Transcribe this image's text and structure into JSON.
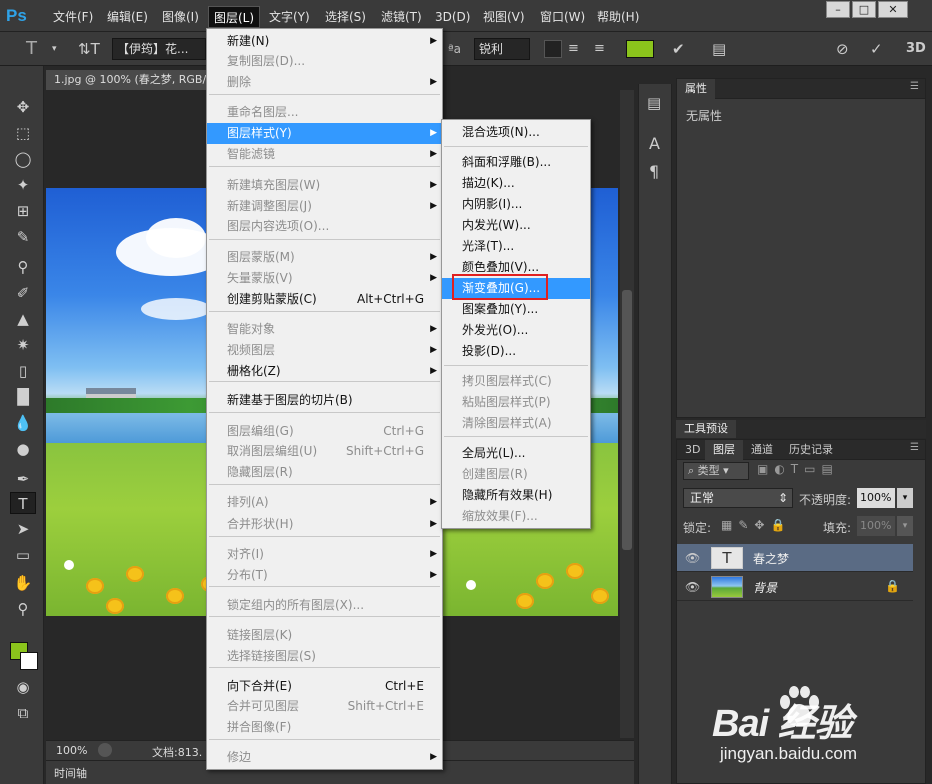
{
  "app": {
    "logo": "Ps"
  },
  "menubar": {
    "items": [
      "文件(F)",
      "编辑(E)",
      "图像(I)",
      "图层(L)",
      "文字(Y)",
      "选择(S)",
      "滤镜(T)",
      "3D(D)",
      "视图(V)",
      "窗口(W)",
      "帮助(H)"
    ],
    "active_index": 3
  },
  "options": {
    "font_name": "【伊筠】花...",
    "aa_label": "ªa",
    "aa_mode": "锐利",
    "color": "#8bc41c"
  },
  "document": {
    "tab_title": "1.jpg @ 100% (春之梦, RGB/8)",
    "zoom": "100%",
    "doc_info": "文档:813.",
    "timeline_label": "时间轴"
  },
  "layer_menu": {
    "items": [
      {
        "label": "新建(N)",
        "shortcut": "",
        "submenu": true,
        "disabled": false
      },
      {
        "label": "复制图层(D)...",
        "shortcut": "",
        "submenu": false,
        "disabled": true
      },
      {
        "label": "删除",
        "shortcut": "",
        "submenu": true,
        "disabled": true
      },
      {
        "label": "重命名图层...",
        "shortcut": "",
        "submenu": false,
        "disabled": true
      },
      {
        "label": "图层样式(Y)",
        "shortcut": "",
        "submenu": true,
        "disabled": false
      },
      {
        "label": "智能滤镜",
        "shortcut": "",
        "submenu": true,
        "disabled": true
      },
      {
        "label": "新建填充图层(W)",
        "shortcut": "",
        "submenu": true,
        "disabled": true
      },
      {
        "label": "新建调整图层(J)",
        "shortcut": "",
        "submenu": true,
        "disabled": true
      },
      {
        "label": "图层内容选项(O)...",
        "shortcut": "",
        "submenu": false,
        "disabled": true
      },
      {
        "label": "图层蒙版(M)",
        "shortcut": "",
        "submenu": true,
        "disabled": true
      },
      {
        "label": "矢量蒙版(V)",
        "shortcut": "",
        "submenu": true,
        "disabled": true
      },
      {
        "label": "创建剪贴蒙版(C)",
        "shortcut": "Alt+Ctrl+G",
        "submenu": false,
        "disabled": false
      },
      {
        "label": "智能对象",
        "shortcut": "",
        "submenu": true,
        "disabled": true
      },
      {
        "label": "视频图层",
        "shortcut": "",
        "submenu": true,
        "disabled": true
      },
      {
        "label": "栅格化(Z)",
        "shortcut": "",
        "submenu": true,
        "disabled": false
      },
      {
        "label": "新建基于图层的切片(B)",
        "shortcut": "",
        "submenu": false,
        "disabled": false
      },
      {
        "label": "图层编组(G)",
        "shortcut": "Ctrl+G",
        "submenu": false,
        "disabled": true
      },
      {
        "label": "取消图层编组(U)",
        "shortcut": "Shift+Ctrl+G",
        "submenu": false,
        "disabled": true
      },
      {
        "label": "隐藏图层(R)",
        "shortcut": "",
        "submenu": false,
        "disabled": true
      },
      {
        "label": "排列(A)",
        "shortcut": "",
        "submenu": true,
        "disabled": true
      },
      {
        "label": "合并形状(H)",
        "shortcut": "",
        "submenu": true,
        "disabled": true
      },
      {
        "label": "对齐(I)",
        "shortcut": "",
        "submenu": true,
        "disabled": true
      },
      {
        "label": "分布(T)",
        "shortcut": "",
        "submenu": true,
        "disabled": true
      },
      {
        "label": "锁定组内的所有图层(X)...",
        "shortcut": "",
        "submenu": false,
        "disabled": true
      },
      {
        "label": "链接图层(K)",
        "shortcut": "",
        "submenu": false,
        "disabled": true
      },
      {
        "label": "选择链接图层(S)",
        "shortcut": "",
        "submenu": false,
        "disabled": true
      },
      {
        "label": "向下合并(E)",
        "shortcut": "Ctrl+E",
        "submenu": false,
        "disabled": false
      },
      {
        "label": "合并可见图层",
        "shortcut": "Shift+Ctrl+E",
        "submenu": false,
        "disabled": true
      },
      {
        "label": "拼合图像(F)",
        "shortcut": "",
        "submenu": false,
        "disabled": true
      },
      {
        "label": "修边",
        "shortcut": "",
        "submenu": true,
        "disabled": true
      }
    ]
  },
  "style_menu": {
    "items": [
      {
        "label": "混合选项(N)...",
        "disabled": false
      },
      {
        "label": "斜面和浮雕(B)...",
        "disabled": false
      },
      {
        "label": "描边(K)...",
        "disabled": false
      },
      {
        "label": "内阴影(I)...",
        "disabled": false
      },
      {
        "label": "内发光(W)...",
        "disabled": false
      },
      {
        "label": "光泽(T)...",
        "disabled": false
      },
      {
        "label": "颜色叠加(V)...",
        "disabled": false
      },
      {
        "label": "渐变叠加(G)...",
        "disabled": false
      },
      {
        "label": "图案叠加(Y)...",
        "disabled": false
      },
      {
        "label": "外发光(O)...",
        "disabled": false
      },
      {
        "label": "投影(D)...",
        "disabled": false
      },
      {
        "label": "拷贝图层样式(C)",
        "disabled": true
      },
      {
        "label": "粘贴图层样式(P)",
        "disabled": true
      },
      {
        "label": "清除图层样式(A)",
        "disabled": true
      },
      {
        "label": "全局光(L)...",
        "disabled": false
      },
      {
        "label": "创建图层(R)",
        "disabled": true
      },
      {
        "label": "隐藏所有效果(H)",
        "disabled": false
      },
      {
        "label": "缩放效果(F)...",
        "disabled": true
      }
    ],
    "highlighted_index": 7
  },
  "properties_panel": {
    "tab": "属性",
    "content": "无属性"
  },
  "toolpreset": {
    "tab": "工具预设"
  },
  "layers_panel": {
    "tabs": [
      "3D",
      "图层",
      "通道",
      "历史记录"
    ],
    "active_tab": 1,
    "filter_label": "类型",
    "blend_mode": "正常",
    "opacity_label": "不透明度:",
    "opacity_value": "100%",
    "lock_label": "锁定:",
    "fill_label": "填充:",
    "fill_value": "100%",
    "layers": [
      {
        "name": "春之梦",
        "type": "text"
      },
      {
        "name": "背景",
        "type": "image"
      }
    ]
  },
  "watermark": {
    "brand": "Bai  经验",
    "url": "jingyan.baidu.com"
  }
}
